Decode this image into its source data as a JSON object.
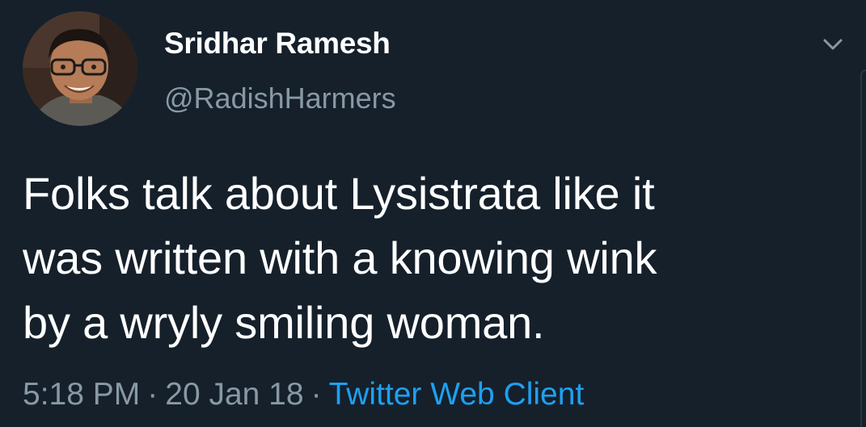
{
  "author": {
    "display_name": "Sridhar Ramesh",
    "handle": "@RadishHarmers"
  },
  "tweet": {
    "lines": [
      "Folks talk about Lysistrata like it",
      "was written with a knowing wink",
      "by a wryly smiling woman."
    ]
  },
  "meta": {
    "time": "5:18 PM",
    "date": "20 Jan 18",
    "separator": "·",
    "client": "Twitter Web Client"
  },
  "icons": {
    "caret": "chevron-down-icon",
    "avatar": "profile-photo"
  },
  "colors": {
    "background": "#15202b",
    "primary_text": "#ffffff",
    "secondary_text": "#8899a6",
    "link": "#1da1f2"
  }
}
